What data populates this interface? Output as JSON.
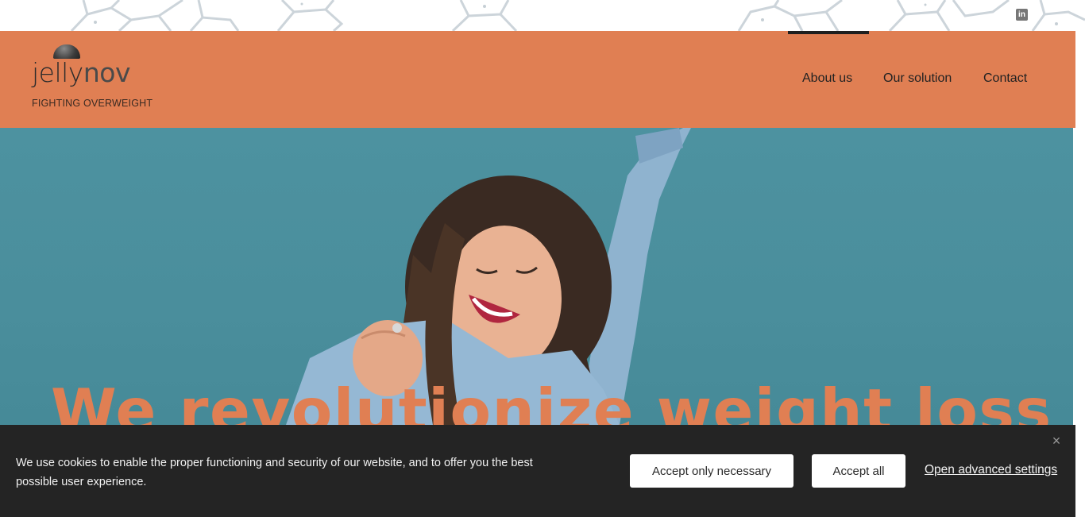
{
  "topbar": {
    "social_icon": "linkedin-icon",
    "social_glyph": "in"
  },
  "header": {
    "logo": {
      "word_main": "jelly",
      "word_accent": "nov",
      "tagline": "FIGHTING OVERWEIGHT"
    },
    "nav": [
      {
        "label": "About us",
        "active": true
      },
      {
        "label": "Our solution",
        "active": false
      },
      {
        "label": "Contact",
        "active": false
      }
    ]
  },
  "hero": {
    "headline": "We revolutionize weight loss"
  },
  "cookie_banner": {
    "message": "We use cookies to enable the proper functioning and security of our website, and to offer you the best possible user experience.",
    "accept_necessary_label": "Accept only necessary",
    "accept_all_label": "Accept all",
    "advanced_settings_label": "Open advanced settings",
    "close_glyph": "×"
  },
  "colors": {
    "brand_orange": "#e07f53",
    "hero_teal": "#4a8e9c",
    "banner_bg": "#242424"
  }
}
